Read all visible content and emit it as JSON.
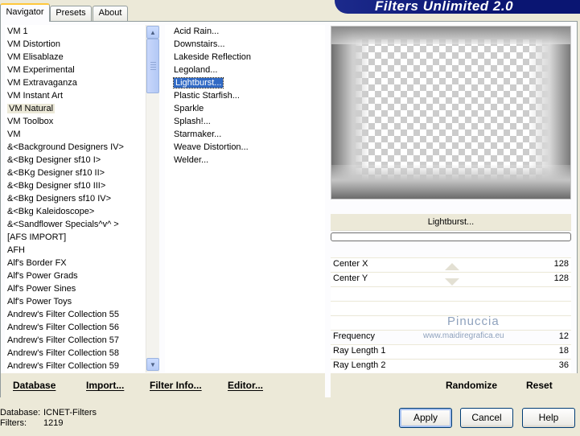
{
  "tabs": [
    "Navigator",
    "Presets",
    "About"
  ],
  "banner_title": "Filters Unlimited 2.0",
  "categories": [
    "VM 1",
    "VM Distortion",
    "VM Elisablaze",
    "VM Experimental",
    "VM Extravaganza",
    "VM Instant Art",
    "VM Natural",
    "VM Toolbox",
    "VM",
    "&<Background Designers IV>",
    "&<Bkg Designer sf10 I>",
    "&<BKg Designer sf10 II>",
    "&<Bkg Designer sf10 III>",
    "&<Bkg Designers sf10 IV>",
    "&<Bkg Kaleidoscope>",
    "&<Sandflower Specials^v^ >",
    "[AFS IMPORT]",
    "AFH",
    "Alf's Border FX",
    "Alf's Power Grads",
    "Alf's Power Sines",
    "Alf's Power Toys",
    "Andrew's Filter Collection 55",
    "Andrew's Filter Collection 56",
    "Andrew's Filter Collection 57",
    "Andrew's Filter Collection 58",
    "Andrew's Filter Collection 59"
  ],
  "selected_category": "VM Natural",
  "filters": [
    "Acid Rain...",
    "Downstairs...",
    "Lakeside Reflection",
    "Legoland...",
    "Lightburst...",
    "Plastic Starfish...",
    "Sparkle",
    "Splash!...",
    "Starmaker...",
    "Weave Distortion...",
    "Welder..."
  ],
  "selected_filter": "Lightburst...",
  "preview_filter_name": "Lightburst...",
  "params": {
    "center_x_label": "Center X",
    "center_x_value": "128",
    "center_y_label": "Center Y",
    "center_y_value": "128",
    "frequency_label": "Frequency",
    "frequency_value": "12",
    "ray1_label": "Ray Length 1",
    "ray1_value": "18",
    "ray2_label": "Ray Length 2",
    "ray2_value": "36"
  },
  "watermark": {
    "name": "Pinuccia",
    "url": "www.maidiregrafica.eu"
  },
  "toolbar": {
    "database": "Database",
    "import": "Import...",
    "filter_info": "Filter Info...",
    "editor": "Editor...",
    "randomize": "Randomize",
    "reset": "Reset"
  },
  "status": {
    "database_label": "Database:",
    "database_value": "ICNET-Filters",
    "filters_label": "Filters:",
    "filters_value": "1219"
  },
  "buttons": {
    "apply": "Apply",
    "cancel": "Cancel",
    "help": "Help"
  }
}
